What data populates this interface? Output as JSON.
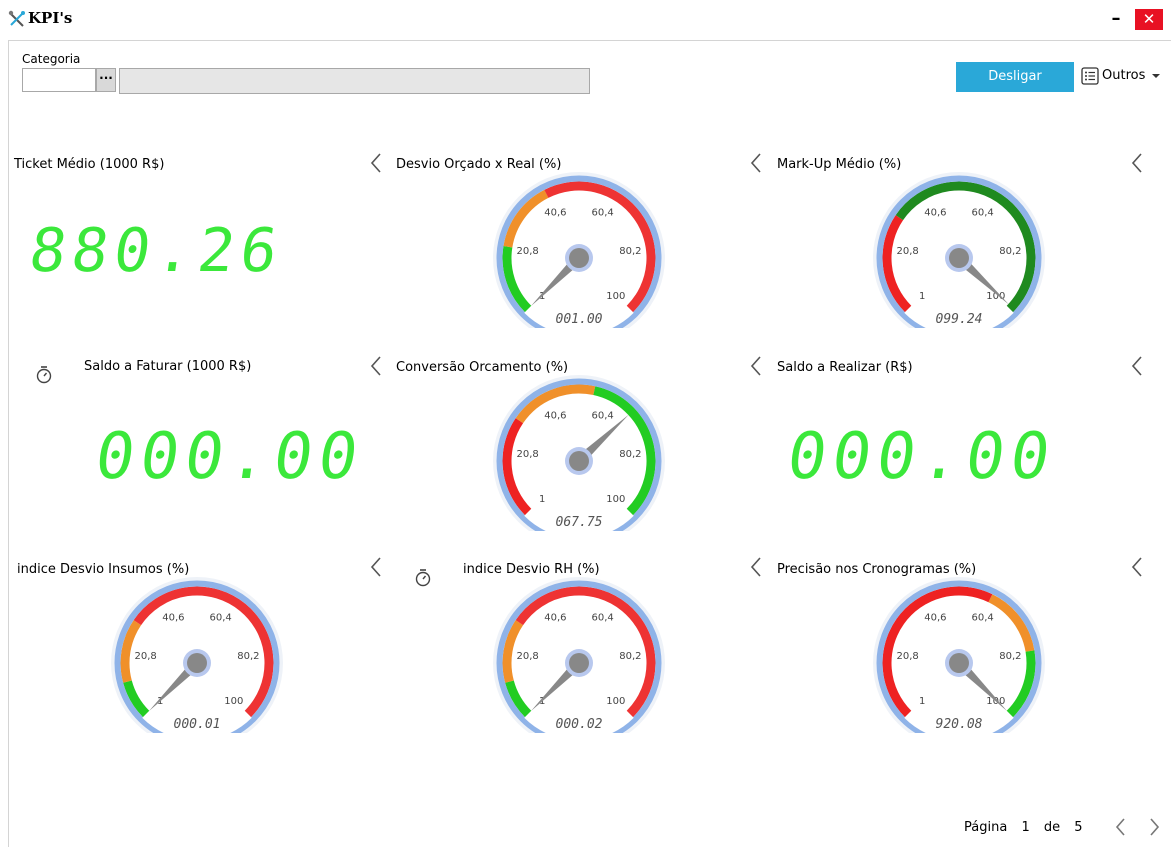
{
  "window": {
    "title": "KPI's",
    "minimize": "–",
    "close": "✕"
  },
  "filter": {
    "label": "Categoria",
    "lookup": "···"
  },
  "toolbar": {
    "desligar": "Desligar",
    "outros": "Outros"
  },
  "widgets": [
    {
      "title": "Ticket Médio (1000 R$)",
      "type": "display",
      "value": "880.26"
    },
    {
      "title": "Desvio Orçado x Real (%)",
      "type": "gauge",
      "value": 1,
      "readout": "001.00",
      "bands": [
        [
          "#22cc22",
          1,
          20.8
        ],
        [
          "#f0902a",
          20.8,
          40.6
        ],
        [
          "#ee3333",
          40.6,
          100
        ]
      ]
    },
    {
      "title": "Mark-Up Médio (%)",
      "type": "gauge",
      "value": 99.24,
      "readout": "099.24",
      "bands": [
        [
          "#ee2222",
          1,
          30
        ],
        [
          "#1f8a1f",
          30,
          100
        ]
      ]
    },
    {
      "title": "Saldo a Faturar (1000 R$)",
      "type": "display",
      "value": "000.00"
    },
    {
      "title": "Conversão Orcamento (%)",
      "type": "gauge",
      "value": 67.75,
      "readout": "067.75",
      "bands": [
        [
          "#ee2222",
          1,
          30
        ],
        [
          "#f0902a",
          30,
          55
        ],
        [
          "#22cc22",
          55,
          100
        ]
      ]
    },
    {
      "title": "Saldo a Realizar (R$)",
      "type": "display",
      "value": "000.00"
    },
    {
      "title": "indice Desvio Insumos (%)",
      "type": "gauge",
      "value": 1,
      "readout": "000.01",
      "bands": [
        [
          "#22cc22",
          1,
          12
        ],
        [
          "#f0902a",
          12,
          30
        ],
        [
          "#ee3333",
          30,
          100
        ]
      ]
    },
    {
      "title": "indice Desvio RH (%)",
      "type": "gauge",
      "value": 1,
      "readout": "000.02",
      "bands": [
        [
          "#22cc22",
          1,
          12
        ],
        [
          "#f0902a",
          12,
          30
        ],
        [
          "#ee3333",
          30,
          100
        ]
      ]
    },
    {
      "title": "Precisão nos Cronogramas (%)",
      "type": "gauge",
      "value": 100,
      "readout": "920.08",
      "bands": [
        [
          "#ee2222",
          1,
          60
        ],
        [
          "#f0902a",
          60,
          80
        ],
        [
          "#22cc22",
          80,
          100
        ]
      ]
    }
  ],
  "gauge_scale": {
    "min": 1,
    "max": 100,
    "ticks": [
      "1",
      "20,8",
      "40,6",
      "60,4",
      "80,2",
      "100"
    ]
  },
  "pagination": {
    "label": "Página",
    "current": "1",
    "of": "de",
    "total": "5"
  },
  "colors": {
    "accent": "#2aa8d8",
    "segment": "#3be83b",
    "close": "#e81123"
  },
  "icons": [
    "tools-icon",
    "list-icon",
    "chevron-left-icon",
    "timer-icon",
    "chevron-right-icon"
  ]
}
